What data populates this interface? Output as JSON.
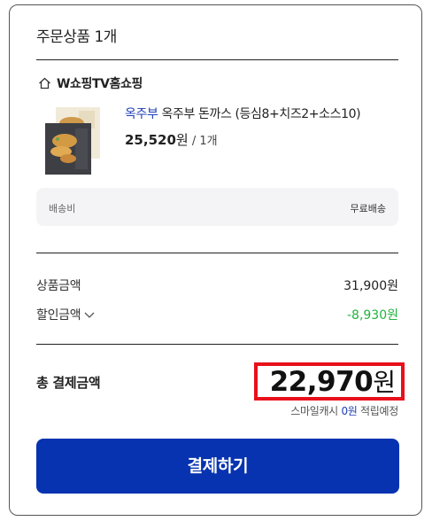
{
  "header": {
    "title": "주문상품 1개"
  },
  "store": {
    "name": "W쇼핑TV홈쇼핑",
    "icon": "home-icon"
  },
  "product": {
    "brand": "옥주부",
    "name": " 옥주부 돈까스 (등심8+치즈2+소스10)",
    "price": "25,520",
    "price_unit": "원",
    "qty": " / 1개"
  },
  "shipping": {
    "label": "배송비",
    "value": "무료배송"
  },
  "summary": {
    "product_amount_label": "상품금액",
    "product_amount": "31,900원",
    "discount_label": "할인금액",
    "discount_amount": "-8,930원"
  },
  "total": {
    "label": "총 결제금액",
    "amount": "22,970",
    "unit": "원"
  },
  "reward": {
    "prefix": "스마일캐시 ",
    "points": "0원",
    "suffix": " 적립예정"
  },
  "pay_button": {
    "label": "결제하기"
  },
  "colors": {
    "accent": "#0733b0",
    "brand_text": "#1f3fb4",
    "discount": "#21b33d",
    "highlight": "#e8101b"
  }
}
